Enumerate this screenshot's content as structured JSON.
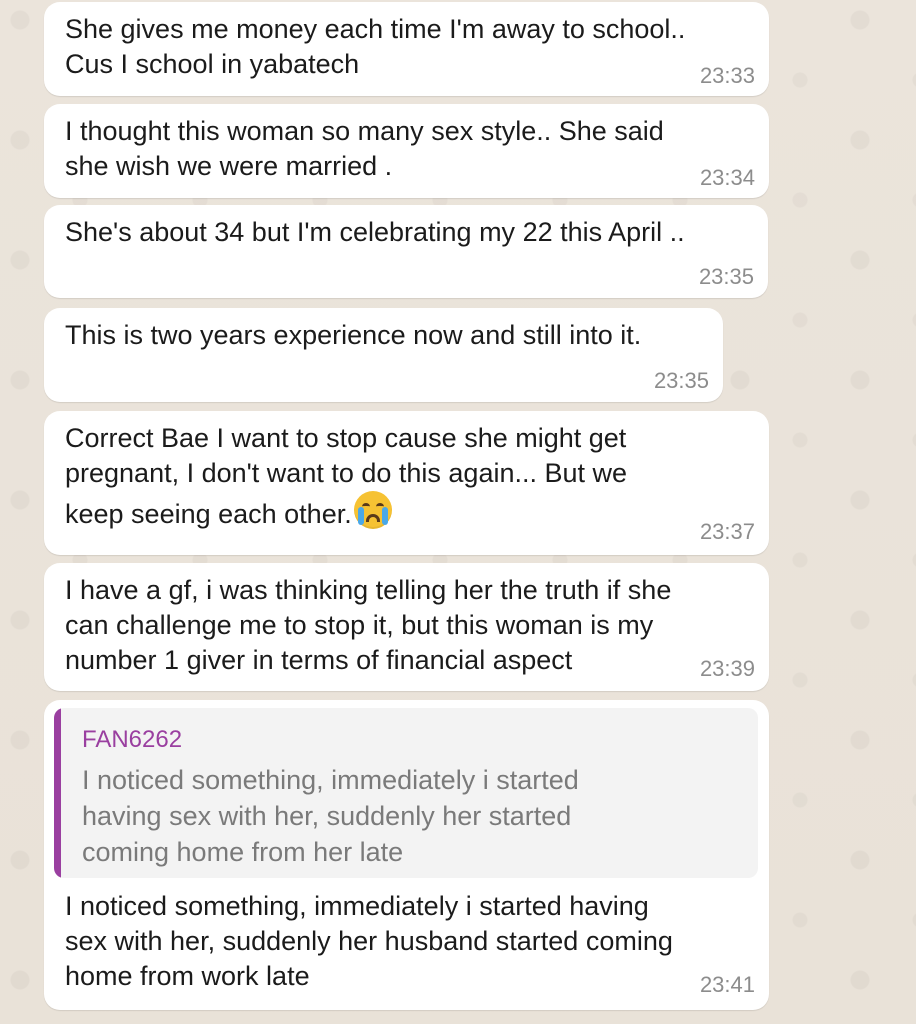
{
  "chat": {
    "messages": [
      {
        "text": "She gives me money each time I'm away to school..\nCus I school in yabatech",
        "time": "23:33"
      },
      {
        "text": "I thought this woman so many sex style.. She said\nshe wish we were married .",
        "time": "23:34"
      },
      {
        "text": "She's about 34 but I'm celebrating my 22 this April ..",
        "time": "23:35"
      },
      {
        "text": "This is two years experience now and still into it.",
        "time": "23:35"
      },
      {
        "text": "Correct Bae I want to stop cause she might get\npregnant, I don't want to do this again... But we\nkeep seeing each other.",
        "emoji": "😭",
        "time": "23:37"
      },
      {
        "text": "I have a gf, i was thinking telling her the truth if she\ncan challenge me to stop it, but this woman is my\nnumber 1 giver in terms of financial aspect",
        "time": "23:39"
      },
      {
        "quote_author": "FAN6262",
        "quote_text": "I noticed something, immediately i started\nhaving sex with her, suddenly her started\ncoming home from her late",
        "text": "I noticed something, immediately i started having\nsex with her, suddenly her husband started coming\nhome from work late",
        "time": "23:41"
      }
    ]
  },
  "icons": {
    "emoji": "loudly-crying-face-icon"
  },
  "colors": {
    "wallpaper": "#ece5dd",
    "bubble": "#ffffff",
    "quote_accent": "#9a3fa0",
    "timestamp": "#8c8c8c"
  }
}
